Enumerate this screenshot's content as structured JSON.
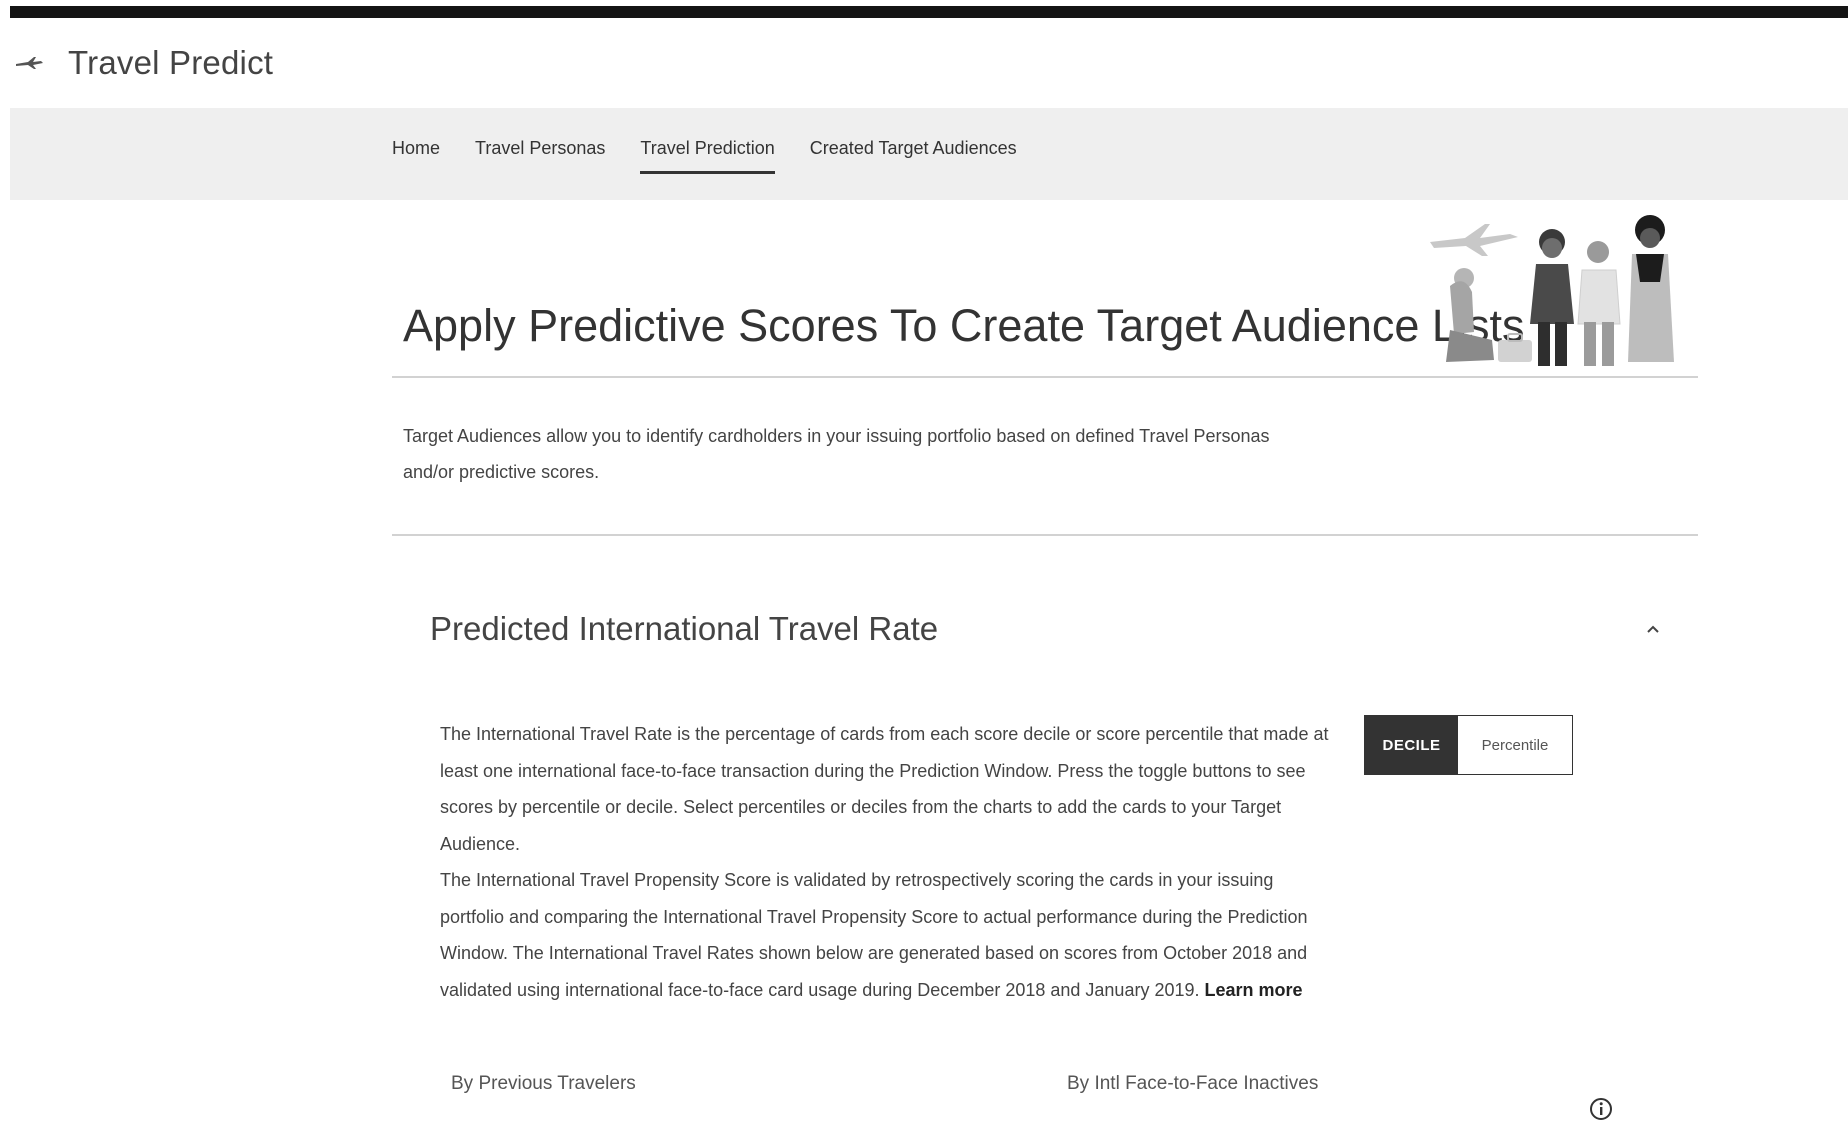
{
  "app": {
    "title": "Travel Predict",
    "logo_icon": "plane-icon"
  },
  "nav": {
    "tabs": [
      {
        "label": "Home",
        "active": false
      },
      {
        "label": "Travel Personas",
        "active": false
      },
      {
        "label": "Travel Prediction",
        "active": true
      },
      {
        "label": "Created Target Audiences",
        "active": false
      }
    ]
  },
  "hero": {
    "title": "Apply Predictive Scores To Create Target Audience Lists",
    "illustration_icon": "travelers-illustration"
  },
  "intro": {
    "text": "Target Audiences allow you to identify cardholders in your issuing portfolio based on defined Travel Personas and/or predictive scores."
  },
  "section": {
    "title": "Predicted International Travel Rate",
    "collapse_icon": "chevron-up-icon",
    "paragraph1": "The International Travel Rate is the percentage of cards from each score decile or score percentile that made at least one international face-to-face transaction during the Prediction Window. Press the toggle buttons to see scores by percentile or decile. Select percentiles or deciles from the charts to add the cards to your Target Audience.",
    "paragraph2": "The International Travel Propensity Score is validated by retrospectively scoring the cards in your issuing portfolio and comparing the International Travel Propensity Score to actual performance during the Prediction Window. The International Travel Rates shown below are generated based on scores from October 2018 and validated using international face-to-face card usage during December 2018 and January 2019.",
    "learn_more": "Learn more",
    "toggle": {
      "decile": "DECILE",
      "percentile": "Percentile",
      "selected": "DECILE"
    },
    "chart_labels": {
      "left": "By Previous Travelers",
      "right": "By Intl Face-to-Face Inactives"
    },
    "info_icon": "info-icon"
  },
  "colors": {
    "accent_dark": "#333333",
    "nav_background": "#efefef",
    "top_bar": "#141414"
  }
}
